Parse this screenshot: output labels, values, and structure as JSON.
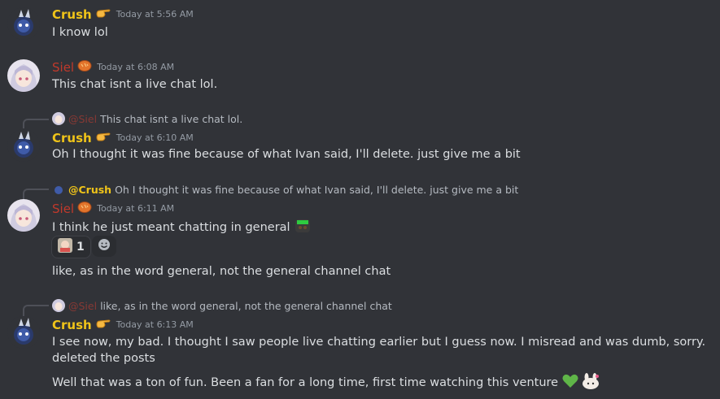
{
  "messages": [
    {
      "author": "Crush",
      "timestamp": "Today at 5:56 AM",
      "text": "I know lol"
    },
    {
      "author": "Siel",
      "timestamp": "Today at 6:08 AM",
      "text": "This chat isnt a live chat lol."
    },
    {
      "reply_mention": "@Siel",
      "reply_text": "This chat isnt a live chat lol.",
      "author": "Crush",
      "timestamp": "Today at 6:10 AM",
      "text": "Oh I thought it was fine because of what Ivan said, I'll delete. just give me a bit"
    },
    {
      "reply_mention": "@Crush",
      "reply_text": "Oh I thought it was fine because of what Ivan said, I'll delete. just give me a bit",
      "author": "Siel",
      "timestamp": "Today at 6:11 AM",
      "text": "I think he just meant chatting in general",
      "reaction_count": "1",
      "text2": "like, as in the word general, not the general channel chat"
    },
    {
      "reply_mention": "@Siel",
      "reply_text": "like, as in the word general, not the general channel chat",
      "author": "Crush",
      "timestamp": "Today at 6:13 AM",
      "text": "I see now, my bad. I thought I saw people live chatting earlier but I guess now. I misread and was dumb, sorry. deleted the posts",
      "text2": "Well that was a ton of fun. Been a fan for a long time, first time watching this venture"
    }
  ],
  "colors": {
    "background": "#313338",
    "crush_name": "#f0c419",
    "siel_name": "#c0392b",
    "timestamp": "#949ba4"
  }
}
